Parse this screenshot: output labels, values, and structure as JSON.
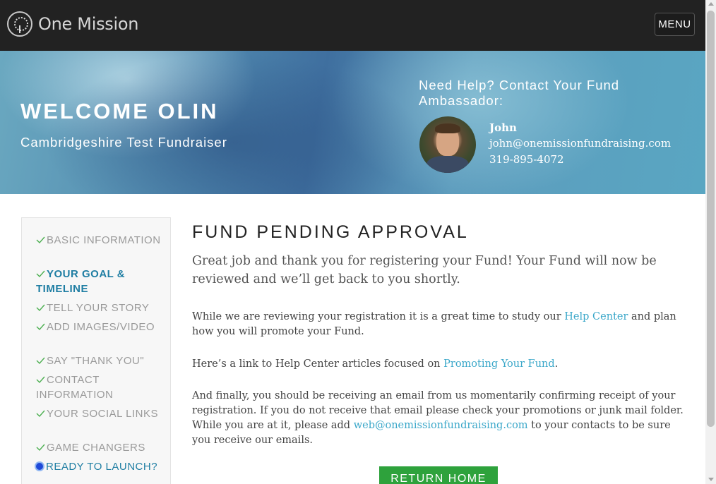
{
  "header": {
    "logo_text": "One Mission",
    "menu_label": "MENU"
  },
  "hero": {
    "welcome": "WELCOME OLIN",
    "fund_name": "Cambridgeshire Test Fundraiser",
    "help_title": "Need Help? Contact Your Fund Ambassador:",
    "ambassador": {
      "name": "John",
      "email": "john@onemissionfundraising.com",
      "phone": "319-895-4072"
    }
  },
  "sidebar": {
    "steps": [
      {
        "label": "BASIC INFORMATION",
        "state": "done"
      },
      {
        "label": "YOUR GOAL & TIMELINE",
        "state": "done-active"
      },
      {
        "label": "TELL YOUR STORY",
        "state": "done"
      },
      {
        "label": "ADD IMAGES/VIDEO",
        "state": "done"
      },
      {
        "label": "SAY \"THANK YOU\"",
        "state": "done"
      },
      {
        "label": "CONTACT INFORMATION",
        "state": "done"
      },
      {
        "label": "YOUR SOCIAL LINKS",
        "state": "done"
      },
      {
        "label": "GAME CHANGERS",
        "state": "done"
      },
      {
        "label": "READY TO LAUNCH?",
        "state": "current"
      }
    ]
  },
  "main": {
    "title": "FUND PENDING APPROVAL",
    "lead": "Great job and thank you for registering your Fund! Your Fund will now be reviewed and we’ll get back to you shortly.",
    "p1_before": "While we are reviewing your registration it is a great time to study our ",
    "p1_link": "Help Center",
    "p1_after": " and plan how you will promote your Fund.",
    "p2_before": "Here’s a link to Help Center articles focused on ",
    "p2_link": "Promoting Your Fund",
    "p2_after": ".",
    "p3_before": "And finally, you should be receiving an email from us momentarily confirming receipt of your registration. If you do not receive that email please check your promotions or junk mail folder. While you are at it, please add ",
    "p3_link": "web@onemissionfundraising.com",
    "p3_after": " to your contacts to be sure you receive our emails.",
    "return_label": "RETURN HOME"
  },
  "colors": {
    "topbar": "#222222",
    "accent": "#1f7ea3",
    "link": "#3aa7c9",
    "check": "#4caf50",
    "button": "#2ea23c"
  },
  "icons": {
    "done_step": "check-icon",
    "current_step": "radio-dot-icon"
  }
}
